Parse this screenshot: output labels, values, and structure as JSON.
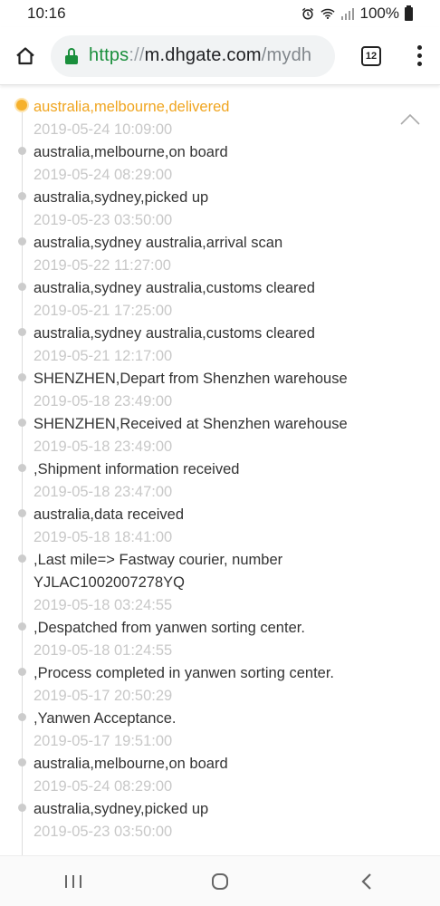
{
  "status_bar": {
    "time": "10:16",
    "battery_text": "100%",
    "icons": [
      "alarm-icon",
      "wifi-icon",
      "signal-icon",
      "battery-icon"
    ]
  },
  "browser": {
    "url_scheme": "https",
    "url_separator": "://",
    "url_host": "m.dhgate.com",
    "url_rest": "/mydh",
    "tab_count": "12",
    "accent_color": "#1a8f3c"
  },
  "tracking": {
    "current_color": "#f0a51f",
    "events": [
      {
        "description": "australia,melbourne,delivered",
        "time": "2019-05-24 10:09:00"
      },
      {
        "description": "australia,melbourne,on board",
        "time": "2019-05-24 08:29:00"
      },
      {
        "description": "australia,sydney,picked up",
        "time": "2019-05-23 03:50:00"
      },
      {
        "description": "australia,sydney australia,arrival scan",
        "time": "2019-05-22 11:27:00"
      },
      {
        "description": "australia,sydney australia,customs cleared",
        "time": "2019-05-21 17:25:00"
      },
      {
        "description": "australia,sydney australia,customs cleared",
        "time": "2019-05-21 12:17:00"
      },
      {
        "description": "SHENZHEN,Depart from Shenzhen warehouse",
        "time": "2019-05-18 23:49:00"
      },
      {
        "description": "SHENZHEN,Received at Shenzhen warehouse",
        "time": "2019-05-18 23:49:00"
      },
      {
        "description": ",Shipment information received",
        "time": "2019-05-18 23:47:00"
      },
      {
        "description": "australia,data received",
        "time": "2019-05-18 18:41:00"
      },
      {
        "description": ",Last mile=> Fastway courier, number YJLAC1002007278YQ",
        "time": "2019-05-18 03:24:55"
      },
      {
        "description": ",Despatched from yanwen sorting center.",
        "time": "2019-05-18 01:24:55"
      },
      {
        "description": ",Process completed in yanwen sorting center.",
        "time": "2019-05-17 20:50:29"
      },
      {
        "description": ",Yanwen Acceptance.",
        "time": "2019-05-17 19:51:00"
      },
      {
        "description": "australia,melbourne,on board",
        "time": "2019-05-24 08:29:00"
      },
      {
        "description": "australia,sydney,picked up",
        "time": "2019-05-23 03:50:00"
      }
    ]
  },
  "nav_bar": {
    "buttons": [
      "recent-apps-icon",
      "home-icon",
      "back-icon"
    ]
  }
}
